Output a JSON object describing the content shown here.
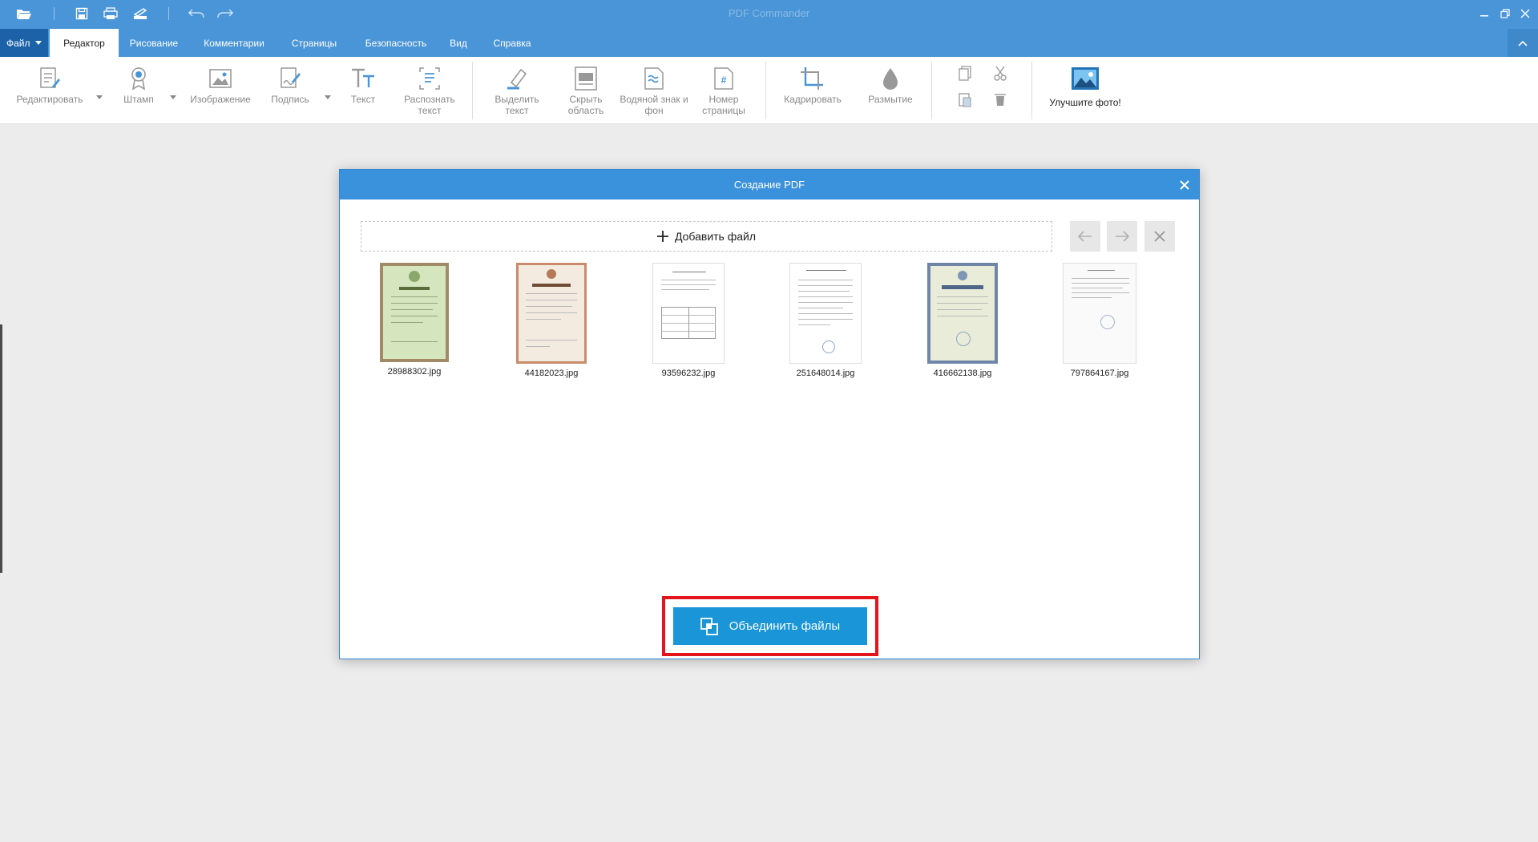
{
  "app": {
    "title": "PDF Commander",
    "window_controls": [
      "minimize-icon",
      "restore-icon",
      "close-icon"
    ]
  },
  "quick_access": [
    "open-folder-icon",
    "save-icon",
    "print-icon",
    "scan-icon",
    "undo-icon",
    "redo-icon"
  ],
  "menu": {
    "file_label": "Файл",
    "tabs": [
      {
        "label": "Редактор",
        "active": true
      },
      {
        "label": "Рисование",
        "active": false
      },
      {
        "label": "Комментарии",
        "active": false
      },
      {
        "label": "Страницы",
        "active": false
      },
      {
        "label": "Безопасность",
        "active": false
      },
      {
        "label": "Вид",
        "active": false
      },
      {
        "label": "Справка",
        "active": false
      }
    ]
  },
  "ribbon": {
    "tools": [
      {
        "label": "Редактировать",
        "icon": "edit-text-icon",
        "dropdown": true
      },
      {
        "label": "Штамп",
        "icon": "stamp-icon",
        "dropdown": true
      },
      {
        "label": "Изображение",
        "icon": "image-icon",
        "dropdown": false
      },
      {
        "label": "Подпись",
        "icon": "signature-icon",
        "dropdown": true
      },
      {
        "label": "Текст",
        "icon": "text-icon",
        "dropdown": false
      },
      {
        "label": "Распознать текст",
        "icon": "ocr-icon",
        "dropdown": false
      },
      {
        "label": "Выделить текст",
        "icon": "highlight-icon",
        "dropdown": false
      },
      {
        "label": "Скрыть область",
        "icon": "hide-area-icon",
        "dropdown": false
      },
      {
        "label": "Водяной знак и фон",
        "icon": "watermark-icon",
        "dropdown": false
      },
      {
        "label": "Номер страницы",
        "icon": "page-number-icon",
        "dropdown": false
      },
      {
        "label": "Кадрировать",
        "icon": "crop-icon",
        "dropdown": false
      },
      {
        "label": "Размытие",
        "icon": "blur-icon",
        "dropdown": false
      }
    ],
    "clipboard_icons": [
      "copy-icon",
      "cut-icon",
      "paste-icon",
      "delete-icon"
    ],
    "enhance_label": "Улучшите фото!"
  },
  "dialog": {
    "title": "Создание PDF",
    "add_file_label": "Добавить файл",
    "files": [
      {
        "name": "28988302.jpg",
        "style": "green-certificate"
      },
      {
        "name": "44182023.jpg",
        "style": "brown-certificate"
      },
      {
        "name": "93596232.jpg",
        "style": "table-document"
      },
      {
        "name": "251648014.jpg",
        "style": "text-document"
      },
      {
        "name": "416662138.jpg",
        "style": "blue-certificate"
      },
      {
        "name": "797864167.jpg",
        "style": "plain-document"
      }
    ],
    "merge_label": "Объединить файлы"
  },
  "colors": {
    "titlebar": "#4a95d7",
    "file_menu": "#1c62a8",
    "dialog_header": "#3a91dc",
    "merge_button": "#1a95d8",
    "highlight": "#e4141b"
  }
}
